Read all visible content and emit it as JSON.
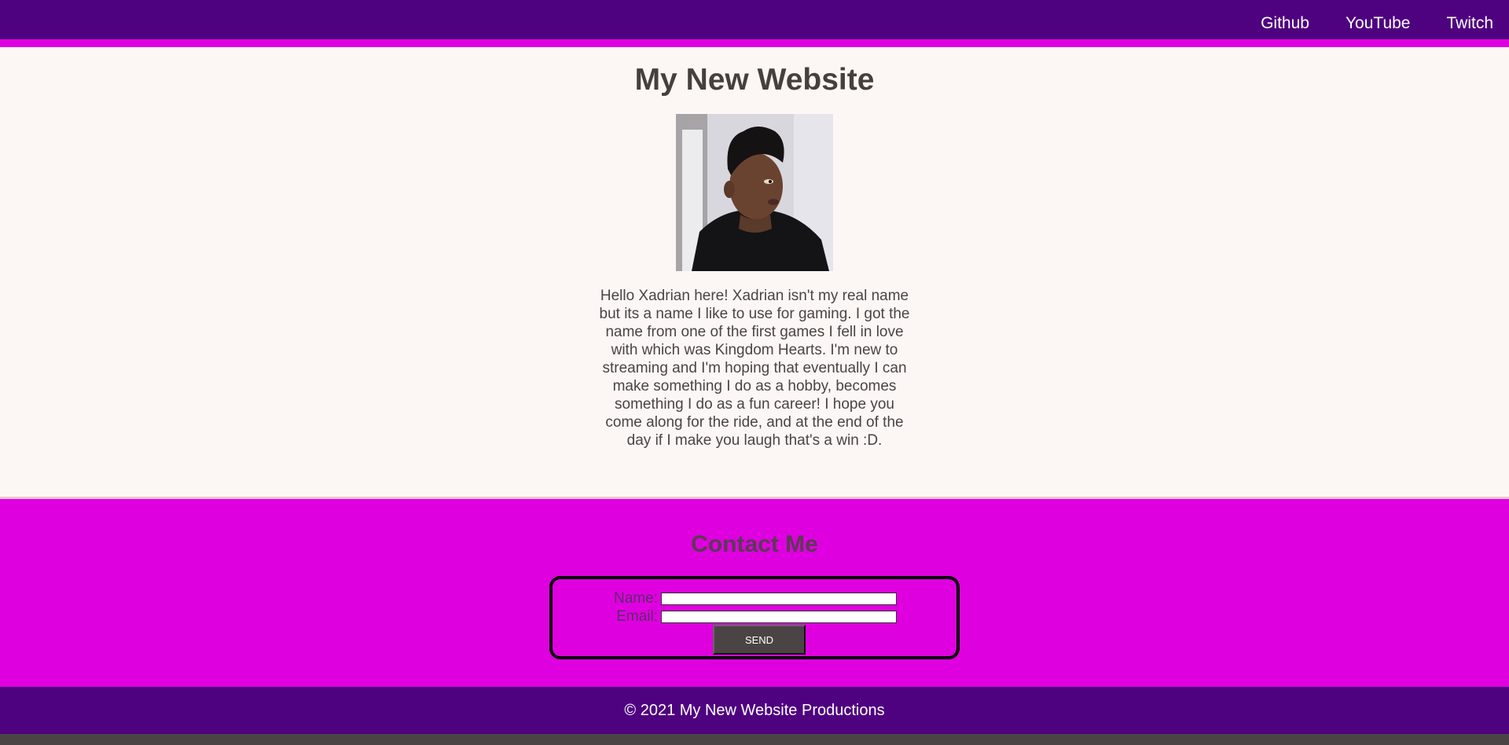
{
  "nav": {
    "items": [
      {
        "label": "Github"
      },
      {
        "label": "YouTube"
      },
      {
        "label": "Twitch"
      }
    ]
  },
  "main": {
    "title": "My New Website",
    "bio": "Hello Xadrian here! Xadrian isn't my real name but its a name I like to use for gaming. I got the name from one of the first games I fell in love with which was Kingdom Hearts. I'm new to streaming and I'm hoping that eventually I can make something I do as a hobby, becomes something I do as a fun career! I hope you come along for the ride, and at the end of the day if I make you laugh that's a win :D."
  },
  "contact": {
    "title": "Contact Me",
    "name_label": "Name:",
    "email_label": "Email:",
    "name_value": "",
    "email_value": "",
    "send_label": "SEND"
  },
  "footer": {
    "text": "© 2021 My New Website Productions"
  },
  "colors": {
    "header_bg": "#4f0280",
    "accent": "#df00df",
    "content_bg": "#fcf7f5",
    "text": "#4a4544"
  }
}
